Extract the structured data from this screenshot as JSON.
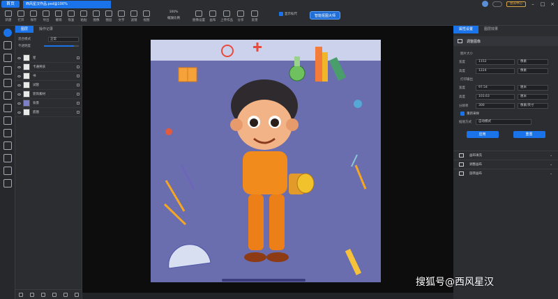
{
  "titlebar": {
    "menu_label": "首页",
    "doc_tab": "西风星汉作品.psd@100%",
    "status_pill": "",
    "vip_label": "会员中心"
  },
  "toolbar": {
    "items": [
      {
        "icon": "new-icon",
        "label": "新建"
      },
      {
        "icon": "open-icon",
        "label": "打开"
      },
      {
        "icon": "save-icon",
        "label": "保存"
      },
      {
        "icon": "export-icon",
        "label": "导出"
      },
      {
        "icon": "undo-icon",
        "label": "撤销"
      },
      {
        "icon": "redo-icon",
        "label": "恢复"
      },
      {
        "icon": "paste-icon",
        "label": "粘贴"
      },
      {
        "icon": "image-icon",
        "label": "图像"
      },
      {
        "icon": "layer-icon",
        "label": "图层"
      },
      {
        "icon": "text-icon",
        "label": "文字"
      },
      {
        "icon": "filter-icon",
        "label": "滤镜"
      },
      {
        "icon": "view-icon",
        "label": "视图"
      }
    ],
    "zoom_value": "100%",
    "zoom_label": "缩放比例",
    "right_items": [
      {
        "icon": "image-settings-icon",
        "label": "图像设置"
      },
      {
        "icon": "canvas-icon",
        "label": "画布"
      },
      {
        "icon": "upload-icon",
        "label": "上传作品"
      },
      {
        "icon": "share-icon",
        "label": "分享"
      },
      {
        "icon": "feedback-icon",
        "label": "反馈"
      }
    ],
    "check_label": "显示标尺",
    "main_action": "智能抠图大师"
  },
  "layers": {
    "tabs": [
      "图层",
      "操作记录"
    ],
    "blend_label": "混合模式",
    "blend_value": "正常",
    "opacity_label": "不透明度",
    "opacity_fraction": 0.85,
    "items": [
      {
        "name": "星",
        "thumb": "light"
      },
      {
        "name": "卡通男孩",
        "thumb": "light"
      },
      {
        "name": "书",
        "thumb": "light"
      },
      {
        "name": "试管",
        "thumb": "light"
      },
      {
        "name": "装饰素材",
        "thumb": "light"
      },
      {
        "name": "背景",
        "thumb": "blue"
      },
      {
        "name": "底图",
        "thumb": "light"
      }
    ]
  },
  "props": {
    "tabs": [
      "属性设置",
      "图层效果"
    ],
    "section_title": "调整图像",
    "size_label": "图片大小",
    "width_label": "宽度",
    "width_value": "1152",
    "height_label": "高度",
    "height_value": "1224",
    "unit_px": "像素",
    "print_label": "打印输出",
    "p_width_label": "宽度",
    "p_width_value": "97.54",
    "p_height_label": "高度",
    "p_height_value": "103.63",
    "unit_cm": "厘米",
    "res_label": "分辨率",
    "res_value": "300",
    "res_unit": "像素/英寸",
    "resample_label": "重新采样",
    "resample_method_label": "插值方式",
    "resample_method_value": "自动模式",
    "apply_label": "应用",
    "reset_label": "重置",
    "collapsed": [
      {
        "icon": "expand-icon",
        "label": "画布填充"
      },
      {
        "icon": "crop-icon",
        "label": "调整画布"
      },
      {
        "icon": "rotate-icon",
        "label": "旋转画布"
      }
    ]
  },
  "canvas": {
    "background": "#6a6dae",
    "top_band": "#ccd1ec"
  },
  "watermark": "搜狐号@西风星汉"
}
